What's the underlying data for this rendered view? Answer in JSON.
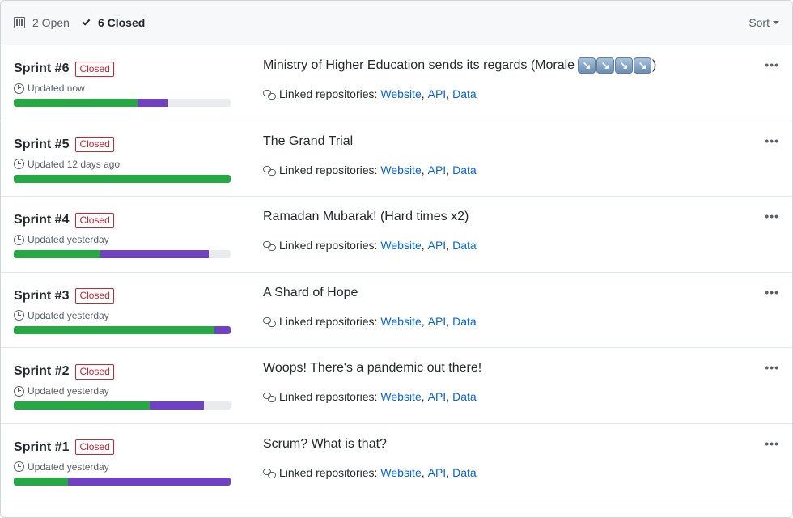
{
  "header": {
    "open_label": "2 Open",
    "closed_label": "6 Closed",
    "sort_label": "Sort"
  },
  "colors": {
    "done": "#28a745",
    "in_progress": "#6f42c1",
    "todo": "#e9ebef",
    "closed_badge": "#cb2431",
    "link": "#0366d6"
  },
  "linked_label": "Linked repositories:",
  "more_label": "•••",
  "projects": [
    {
      "name": "Sprint #6",
      "status": "Closed",
      "updated": "Updated now",
      "description": "Ministry of Higher Education sends its regards (Morale",
      "emoji_count": 4,
      "emoji": "↘",
      "description_suffix": ")",
      "progress": {
        "done_pct": 57,
        "in_progress_pct": 14
      },
      "repos": [
        "Website",
        "API",
        "Data"
      ]
    },
    {
      "name": "Sprint #5",
      "status": "Closed",
      "updated": "Updated 12 days ago",
      "description": "The Grand Trial",
      "emoji_count": 0,
      "description_suffix": "",
      "progress": {
        "done_pct": 100,
        "in_progress_pct": 0
      },
      "repos": [
        "Website",
        "API",
        "Data"
      ]
    },
    {
      "name": "Sprint #4",
      "status": "Closed",
      "updated": "Updated yesterday",
      "description": "Ramadan Mubarak! (Hard times x2)",
      "emoji_count": 0,
      "description_suffix": "",
      "progress": {
        "done_pct": 40,
        "in_progress_pct": 50
      },
      "repos": [
        "Website",
        "API",
        "Data"
      ]
    },
    {
      "name": "Sprint #3",
      "status": "Closed",
      "updated": "Updated yesterday",
      "description": "A Shard of Hope",
      "emoji_count": 0,
      "description_suffix": "",
      "progress": {
        "done_pct": 92.5,
        "in_progress_pct": 7.5
      },
      "repos": [
        "Website",
        "API",
        "Data"
      ]
    },
    {
      "name": "Sprint #2",
      "status": "Closed",
      "updated": "Updated yesterday",
      "description": "Woops! There's a pandemic out there!",
      "emoji_count": 0,
      "description_suffix": "",
      "progress": {
        "done_pct": 62.5,
        "in_progress_pct": 25
      },
      "repos": [
        "Website",
        "API",
        "Data"
      ]
    },
    {
      "name": "Sprint #1",
      "status": "Closed",
      "updated": "Updated yesterday",
      "description": "Scrum? What is that?",
      "emoji_count": 0,
      "description_suffix": "",
      "progress": {
        "done_pct": 25,
        "in_progress_pct": 75
      },
      "repos": [
        "Website",
        "API",
        "Data"
      ]
    }
  ]
}
